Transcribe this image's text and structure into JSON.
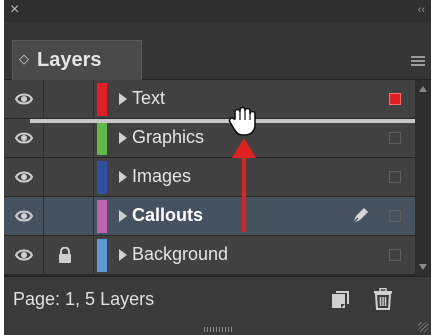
{
  "panel": {
    "close_glyph": "×",
    "collapse_glyph": "‹‹",
    "tab_arrow": "◇",
    "tab_title": "Layers"
  },
  "layers": [
    {
      "name": "Text",
      "color": "#e31e24",
      "visible": true,
      "locked": false,
      "selected": false,
      "has_selected_items": true
    },
    {
      "name": "Graphics",
      "color": "#5dbb46",
      "visible": true,
      "locked": false,
      "selected": false,
      "has_selected_items": false
    },
    {
      "name": "Images",
      "color": "#2f4fa3",
      "visible": true,
      "locked": false,
      "selected": false,
      "has_selected_items": false
    },
    {
      "name": "Callouts",
      "color": "#c062b0",
      "visible": true,
      "locked": false,
      "selected": true,
      "has_selected_items": false,
      "pen_icon": "pen-icon"
    },
    {
      "name": "Background",
      "color": "#5b9bd5",
      "visible": true,
      "locked": true,
      "selected": false,
      "has_selected_items": false
    }
  ],
  "footer": {
    "status": "Page: 1, 5 Layers",
    "new_layer_icon": "new-layer-icon",
    "trash_icon": "trash-icon"
  },
  "annotation": {
    "arrow_color": "#e02020",
    "cursor": "grab-hand-cursor"
  }
}
